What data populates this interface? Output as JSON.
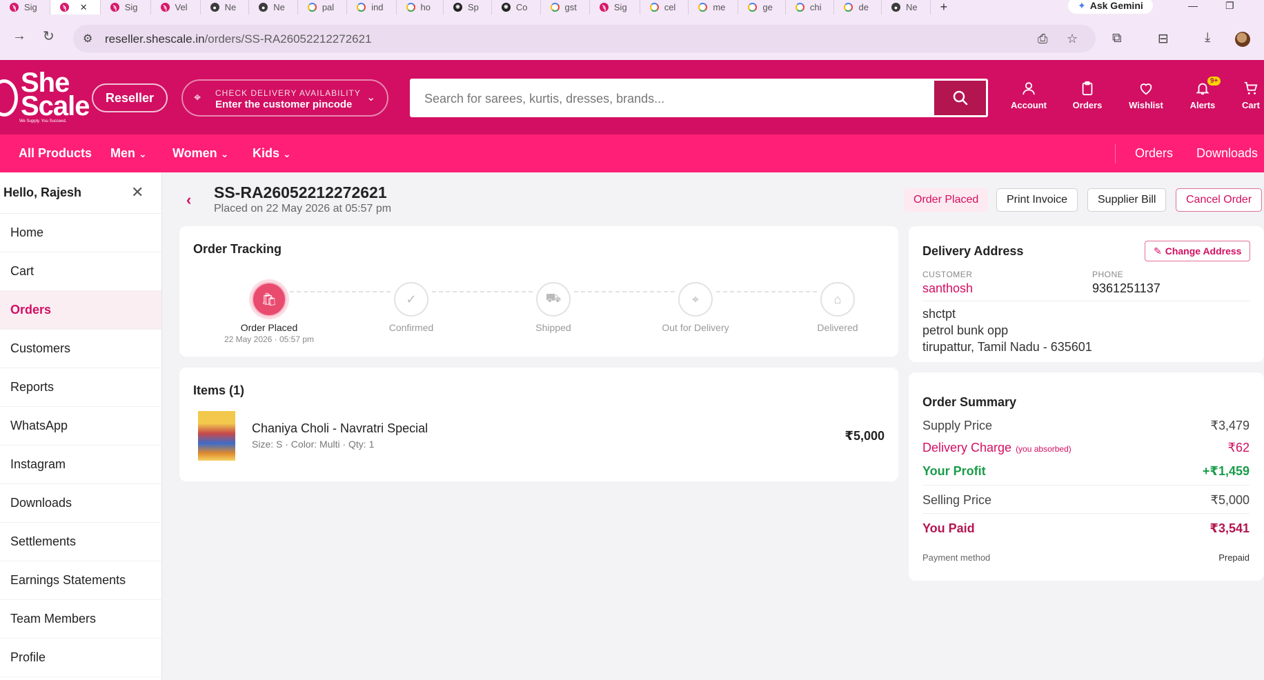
{
  "browser": {
    "tabs": [
      {
        "label": "Sig",
        "favicon": "shescale"
      },
      {
        "label": "",
        "favicon": "shescale",
        "active": true
      },
      {
        "label": "Sig",
        "favicon": "shescale"
      },
      {
        "label": "Vel",
        "favicon": "shescale"
      },
      {
        "label": "Ne",
        "favicon": "globe"
      },
      {
        "label": "Ne",
        "favicon": "globe"
      },
      {
        "label": "pal",
        "favicon": "google"
      },
      {
        "label": "ind",
        "favicon": "google"
      },
      {
        "label": "ho",
        "favicon": "google"
      },
      {
        "label": "Sp",
        "favicon": "chatgpt"
      },
      {
        "label": "Co",
        "favicon": "chatgpt"
      },
      {
        "label": "gst",
        "favicon": "google"
      },
      {
        "label": "Sig",
        "favicon": "shescale"
      },
      {
        "label": "cel",
        "favicon": "google"
      },
      {
        "label": "me",
        "favicon": "google"
      },
      {
        "label": "ge",
        "favicon": "google"
      },
      {
        "label": "chi",
        "favicon": "google"
      },
      {
        "label": "de",
        "favicon": "google"
      },
      {
        "label": "Ne",
        "favicon": "globe"
      }
    ],
    "ask_gemini": "Ask Gemini",
    "url_host": "reseller.shescale.in",
    "url_path": "/orders/SS-RA26052212272621"
  },
  "header": {
    "logo_line1": "She",
    "logo_line2": "Scale",
    "logo_tagline": "We Supply. You Succeed.",
    "reseller_label": "Reseller",
    "pincode_label": "CHECK DELIVERY AVAILABILITY",
    "pincode_value": "Enter the customer pincode",
    "search_placeholder": "Search for sarees, kurtis, dresses, brands...",
    "actions": {
      "account": "Account",
      "orders": "Orders",
      "wishlist": "Wishlist",
      "alerts": "Alerts",
      "alerts_badge": "9+",
      "cart": "Cart"
    }
  },
  "nav": {
    "all_products": "All Products",
    "men": "Men",
    "women": "Women",
    "kids": "Kids",
    "orders": "Orders",
    "downloads": "Downloads"
  },
  "sidebar": {
    "greeting": "Hello, Rajesh",
    "items": [
      {
        "label": "Home"
      },
      {
        "label": "Cart"
      },
      {
        "label": "Orders",
        "active": true
      },
      {
        "label": "Customers"
      },
      {
        "label": "Reports"
      },
      {
        "label": "WhatsApp"
      },
      {
        "label": "Instagram"
      },
      {
        "label": "Downloads"
      },
      {
        "label": "Settlements"
      },
      {
        "label": "Earnings Statements"
      },
      {
        "label": "Team Members"
      },
      {
        "label": "Profile"
      }
    ]
  },
  "order": {
    "id": "SS-RA26052212272621",
    "placed_on": "Placed on 22 May 2026 at 05:57 pm",
    "status": "Order Placed",
    "print_invoice": "Print Invoice",
    "supplier_bill": "Supplier Bill",
    "cancel_order": "Cancel Order"
  },
  "tracking": {
    "title": "Order Tracking",
    "steps": [
      {
        "label": "Order Placed",
        "sub": "22 May 2026 · 05:57 pm",
        "done": true,
        "icon": "bag-icon"
      },
      {
        "label": "Confirmed",
        "sub": "",
        "done": false,
        "icon": "check-circle-icon"
      },
      {
        "label": "Shipped",
        "sub": "",
        "done": false,
        "icon": "truck-icon"
      },
      {
        "label": "Out for Delivery",
        "sub": "",
        "done": false,
        "icon": "location-pin-icon"
      },
      {
        "label": "Delivered",
        "sub": "",
        "done": false,
        "icon": "home-icon"
      }
    ]
  },
  "items": {
    "title": "Items (1)",
    "list": [
      {
        "name": "Chaniya Choli - Navratri Special",
        "meta": "Size: S · Color: Multi · Qty: 1",
        "price": "₹5,000"
      }
    ]
  },
  "address": {
    "title": "Delivery Address",
    "change_label": "Change Address",
    "customer_label": "CUSTOMER",
    "customer_name": "santhosh",
    "phone_label": "PHONE",
    "phone": "9361251137",
    "line1": "shctpt",
    "line2": "petrol bunk opp",
    "line3": "tirupattur, Tamil Nadu - 635601"
  },
  "summary": {
    "title": "Order Summary",
    "supply_label": "Supply Price",
    "supply_value": "₹3,479",
    "delivery_label": "Delivery Charge",
    "delivery_note": "(you absorbed)",
    "delivery_value": "₹62",
    "profit_label": "Your Profit",
    "profit_value": "+₹1,459",
    "selling_label": "Selling Price",
    "selling_value": "₹5,000",
    "paid_label": "You Paid",
    "paid_value": "₹3,541",
    "payment_label": "Payment method",
    "payment_value": "Prepaid"
  },
  "colors": {
    "brand": "#d20f62",
    "nav": "#ff1f77",
    "profit": "#1a9c4a"
  }
}
